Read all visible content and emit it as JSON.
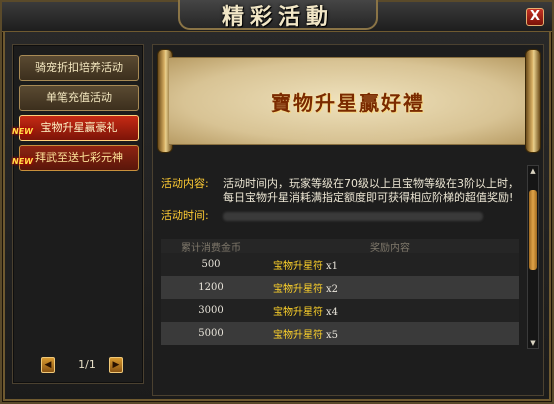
{
  "window": {
    "title": "精彩活動",
    "close_label": "X"
  },
  "sidebar": {
    "items": [
      {
        "label": "骑宠折扣培养活动",
        "active": false,
        "new": false
      },
      {
        "label": "单笔充值活动",
        "active": false,
        "new": false
      },
      {
        "label": "宝物升星赢豪礼",
        "active": true,
        "new": true
      },
      {
        "label": "拜武至送七彩元神",
        "active": false,
        "new": true
      }
    ],
    "new_badge": "NEW",
    "pager": {
      "prev": "◀",
      "next": "▶",
      "text": "1/1"
    }
  },
  "main": {
    "banner_title": "寶物升星贏好禮",
    "content_label": "活动内容:",
    "content_text": "活动时间内，玩家等级在70级以上且宝物等级在3阶以上时，每日宝物升星消耗满指定额度即可获得相应阶梯的超值奖励!",
    "time_label": "活动时间:",
    "table": {
      "headers": [
        "累计消费金币",
        "奖励内容"
      ],
      "rows": [
        {
          "amount": "500",
          "reward": "宝物升星符",
          "qty": "x1"
        },
        {
          "amount": "1200",
          "reward": "宝物升星符",
          "qty": "x2"
        },
        {
          "amount": "3000",
          "reward": "宝物升星符",
          "qty": "x4"
        },
        {
          "amount": "5000",
          "reward": "宝物升星符",
          "qty": "x5"
        }
      ]
    },
    "scrollbar": {
      "up": "▲",
      "down": "▼"
    }
  },
  "colors": {
    "accent_gold": "#ffcc33",
    "active_tab": "#c62a14",
    "reward_text": "#ffd32a"
  }
}
